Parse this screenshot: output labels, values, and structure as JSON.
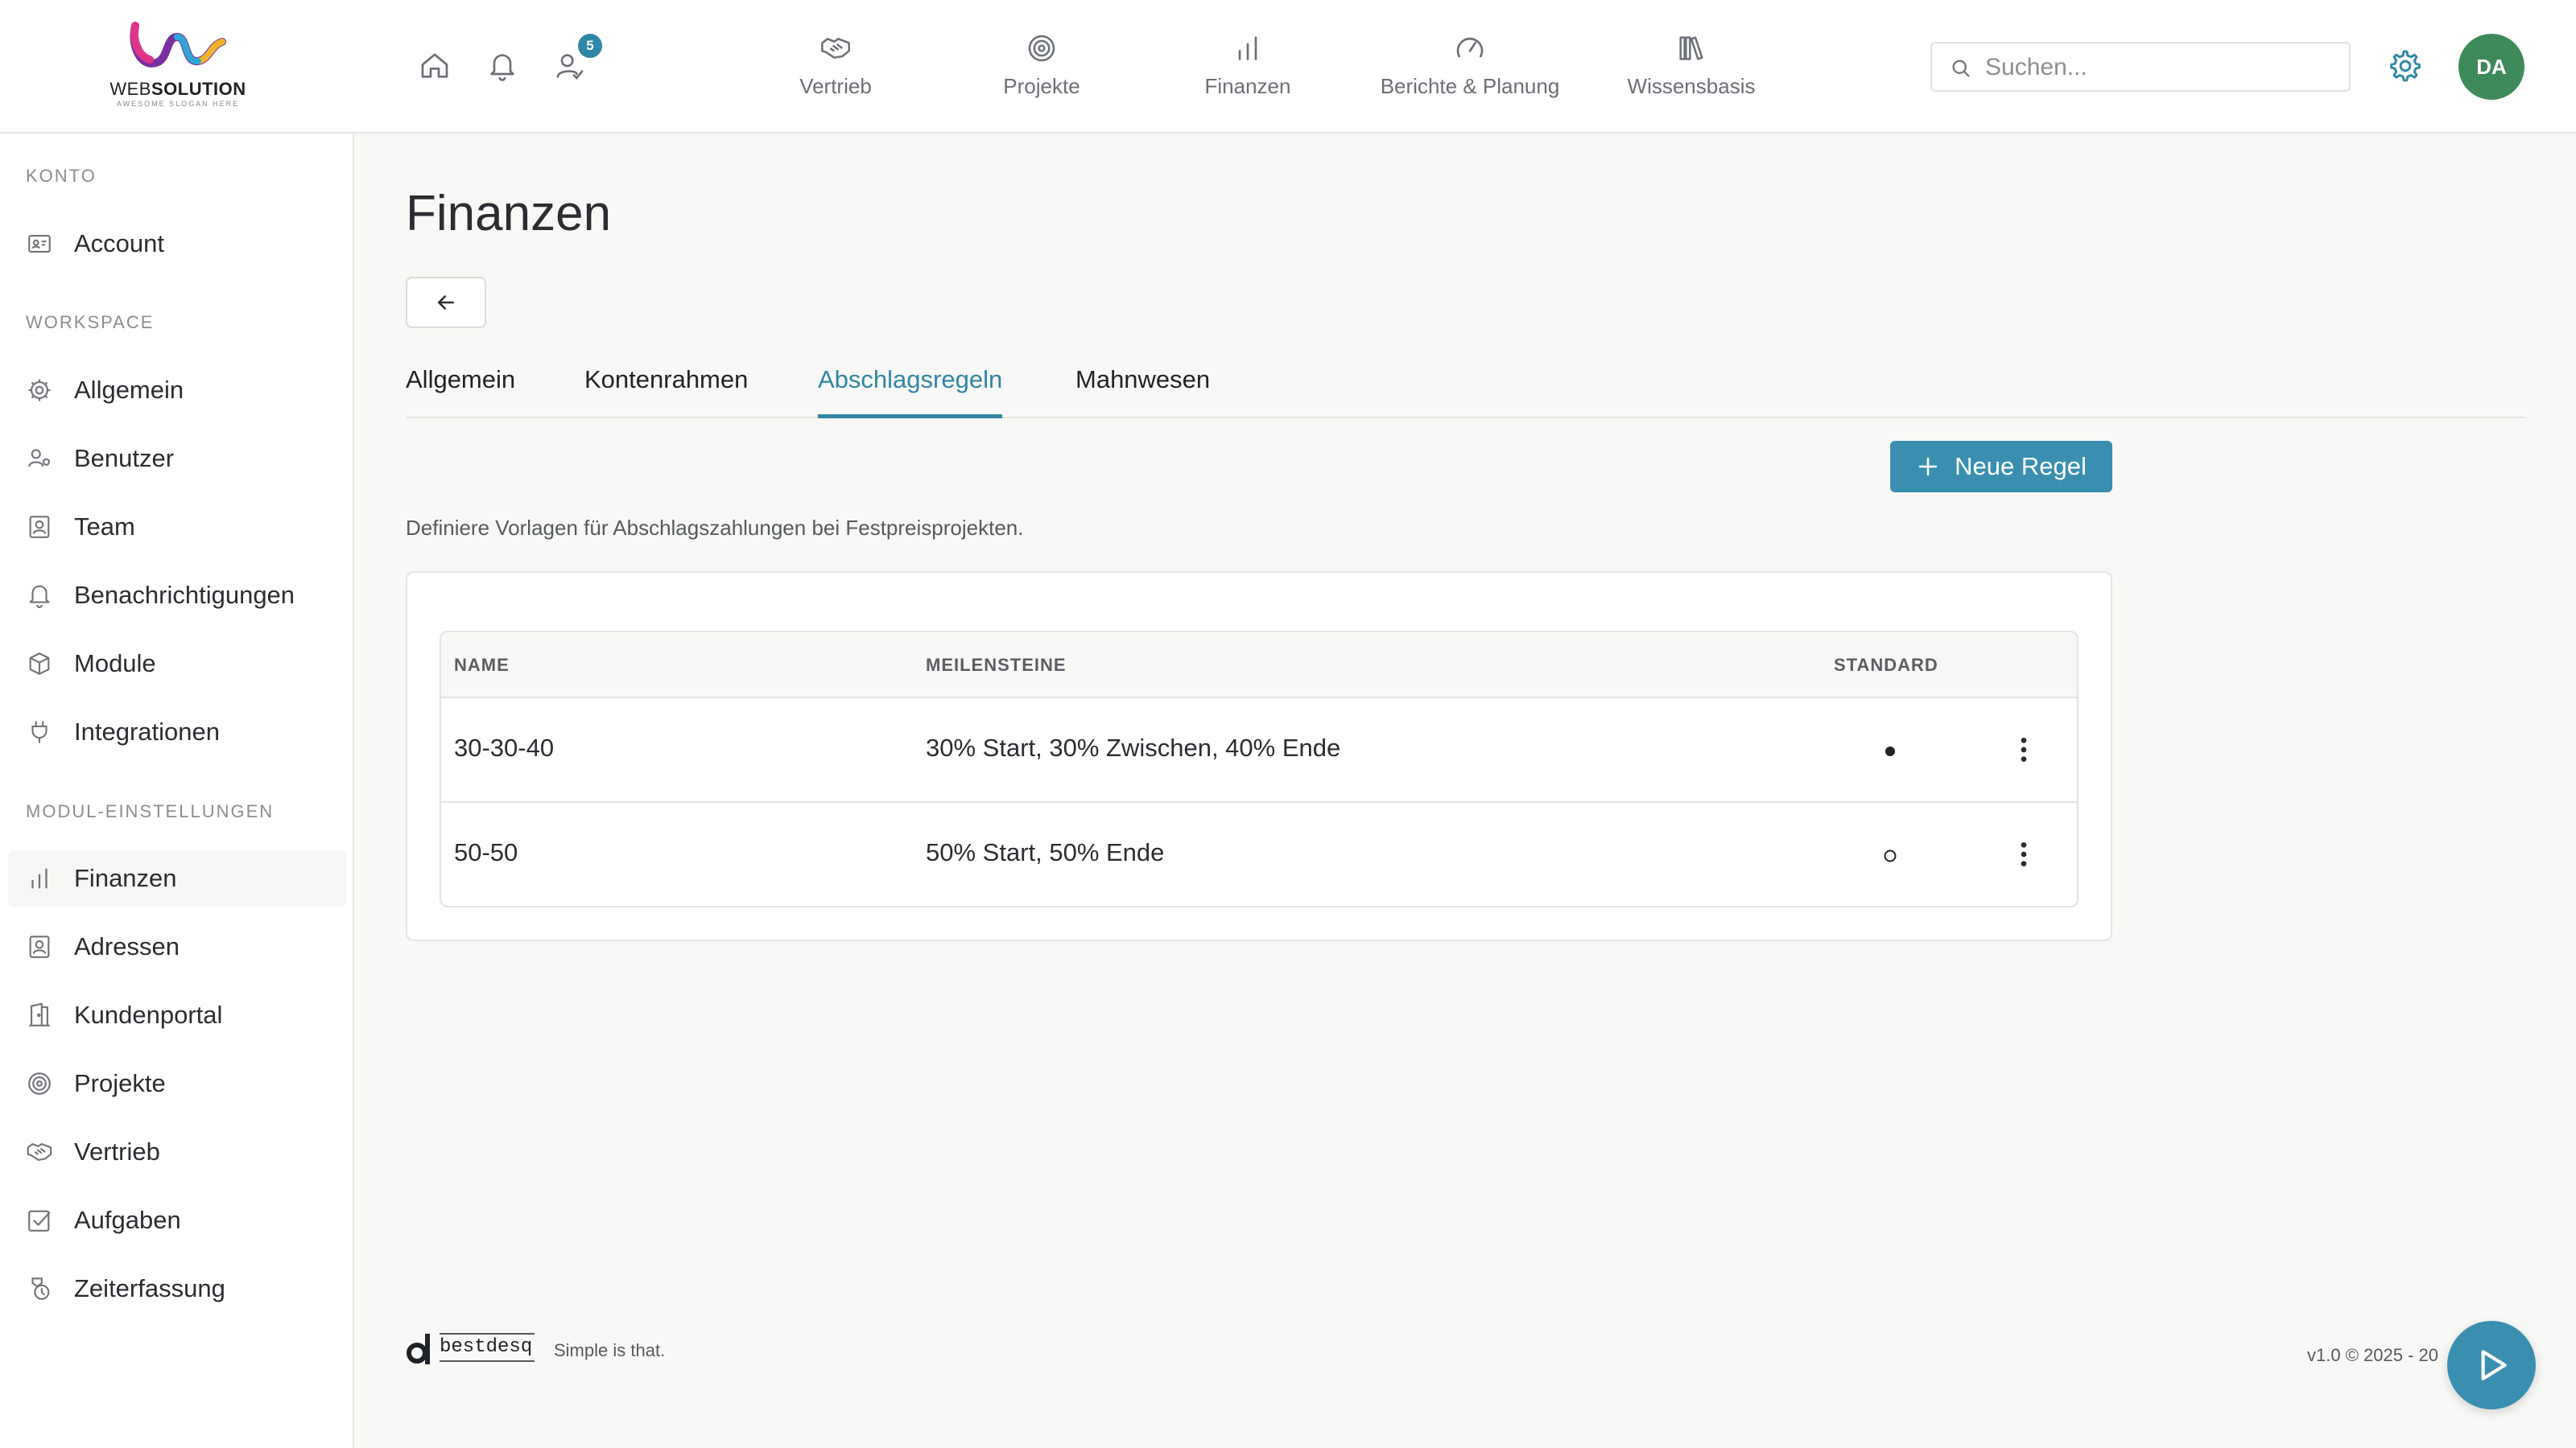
{
  "header": {
    "logo": {
      "brand_prefix": "WEB",
      "brand_suffix": "SOLUTION",
      "slogan": "AWESOME SLOGAN HERE"
    },
    "icons": [
      "home-icon",
      "bell-icon",
      "user-check-icon"
    ],
    "notification_badge": "5",
    "nav": [
      {
        "label": "Vertrieb",
        "icon": "handshake-icon"
      },
      {
        "label": "Projekte",
        "icon": "target-icon"
      },
      {
        "label": "Finanzen",
        "icon": "bar-chart-icon"
      },
      {
        "label": "Berichte & Planung",
        "icon": "gauge-icon"
      },
      {
        "label": "Wissensbasis",
        "icon": "books-icon"
      }
    ],
    "search": {
      "placeholder": "Suchen...",
      "value": ""
    },
    "avatar_initials": "DA",
    "accent_color": "#2f86a6"
  },
  "sidebar": {
    "sections": [
      {
        "label": "KONTO",
        "items": [
          {
            "label": "Account",
            "icon": "id-card-icon"
          }
        ]
      },
      {
        "label": "WORKSPACE",
        "items": [
          {
            "label": "Allgemein",
            "icon": "gear-icon"
          },
          {
            "label": "Benutzer",
            "icon": "users-icon"
          },
          {
            "label": "Team",
            "icon": "team-icon"
          },
          {
            "label": "Benachrichtigungen",
            "icon": "bell-icon"
          },
          {
            "label": "Module",
            "icon": "box-icon"
          },
          {
            "label": "Integrationen",
            "icon": "plug-icon"
          }
        ]
      },
      {
        "label": "MODUL-EINSTELLUNGEN",
        "items": [
          {
            "label": "Finanzen",
            "icon": "bar-chart-icon",
            "active": true
          },
          {
            "label": "Adressen",
            "icon": "contact-icon"
          },
          {
            "label": "Kundenportal",
            "icon": "door-icon"
          },
          {
            "label": "Projekte",
            "icon": "target-icon"
          },
          {
            "label": "Vertrieb",
            "icon": "handshake-icon"
          },
          {
            "label": "Aufgaben",
            "icon": "checkbox-icon"
          },
          {
            "label": "Zeiterfassung",
            "icon": "timer-icon"
          }
        ]
      }
    ]
  },
  "main": {
    "title": "Finanzen",
    "tabs": [
      {
        "label": "Allgemein",
        "active": false
      },
      {
        "label": "Kontenrahmen",
        "active": false
      },
      {
        "label": "Abschlagsregeln",
        "active": true
      },
      {
        "label": "Mahnwesen",
        "active": false
      }
    ],
    "new_rule_label": "Neue Regel",
    "description": "Definiere Vorlagen für Abschlagszahlungen bei Festpreisprojekten.",
    "table": {
      "headers": {
        "name": "NAME",
        "milestones": "MEILENSTEINE",
        "default": "STANDARD"
      },
      "rows": [
        {
          "name": "30-30-40",
          "milestones": "30% Start, 30% Zwischen, 40% Ende",
          "is_default": true
        },
        {
          "name": "50-50",
          "milestones": "50% Start, 50% Ende",
          "is_default": false
        }
      ]
    }
  },
  "footer": {
    "brand": "bestdesq",
    "tagline": "Simple is that.",
    "version": "v1.0 © 2025 - 20"
  }
}
